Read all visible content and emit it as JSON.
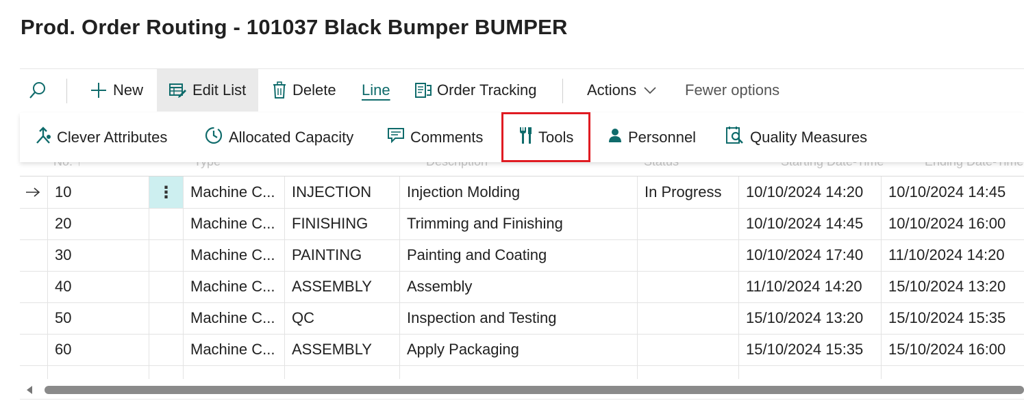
{
  "page": {
    "title": "Prod. Order Routing - 101037 Black Bumper BUMPER"
  },
  "toolbar": {
    "search_icon": "search-icon",
    "new_label": "New",
    "edit_list_label": "Edit List",
    "delete_label": "Delete",
    "line_label": "Line",
    "order_tracking_label": "Order Tracking",
    "actions_label": "Actions",
    "fewer_options_label": "Fewer options"
  },
  "line_menu": {
    "items": [
      {
        "label": "Clever Attributes",
        "icon": "attributes-icon"
      },
      {
        "label": "Allocated Capacity",
        "icon": "capacity-clock-icon"
      },
      {
        "label": "Comments",
        "icon": "comment-icon"
      },
      {
        "label": "Tools",
        "icon": "tools-icon"
      },
      {
        "label": "Personnel",
        "icon": "person-icon"
      },
      {
        "label": "Quality Measures",
        "icon": "quality-icon"
      }
    ],
    "highlighted": "Tools"
  },
  "grid": {
    "header_ghost": [
      "No. ↑",
      "Type",
      "",
      "Description",
      "Status",
      "Starting Date-Time",
      "Ending Date-Time"
    ],
    "rows": [
      {
        "no": "10",
        "type": "Machine C...",
        "machine": "INJECTION",
        "description": "Injection Molding",
        "status": "In Progress",
        "start": "10/10/2024 14:20",
        "end": "10/10/2024 14:45",
        "current": true
      },
      {
        "no": "20",
        "type": "Machine C...",
        "machine": "FINISHING",
        "description": "Trimming and Finishing",
        "status": "",
        "start": "10/10/2024 14:45",
        "end": "10/10/2024 16:00",
        "current": false
      },
      {
        "no": "30",
        "type": "Machine C...",
        "machine": "PAINTING",
        "description": "Painting and Coating",
        "status": "",
        "start": "10/10/2024 17:40",
        "end": "11/10/2024 14:20",
        "current": false
      },
      {
        "no": "40",
        "type": "Machine C...",
        "machine": "ASSEMBLY",
        "description": "Assembly",
        "status": "",
        "start": "11/10/2024 14:20",
        "end": "15/10/2024 13:20",
        "current": false
      },
      {
        "no": "50",
        "type": "Machine C...",
        "machine": "QC",
        "description": "Inspection and Testing",
        "status": "",
        "start": "15/10/2024 13:20",
        "end": "15/10/2024 15:35",
        "current": false
      },
      {
        "no": "60",
        "type": "Machine C...",
        "machine": "ASSEMBLY",
        "description": "Apply Packaging",
        "status": "",
        "start": "15/10/2024 15:35",
        "end": "15/10/2024 16:00",
        "current": false
      }
    ]
  },
  "colors": {
    "accent": "#0f6b6b",
    "highlight_border": "#e01b22",
    "row_actions_bg": "#cdeff0"
  }
}
